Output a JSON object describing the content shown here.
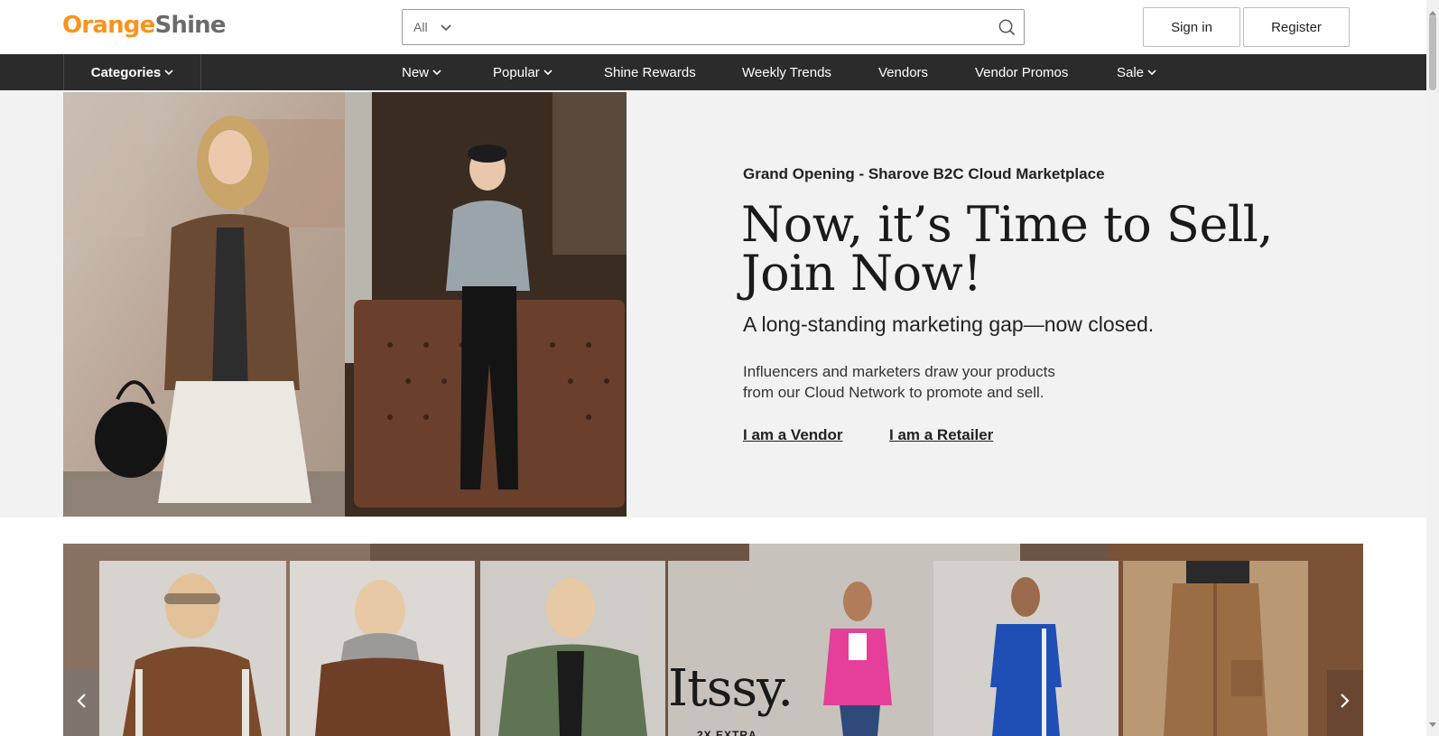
{
  "header": {
    "logo": {
      "part1": "Orange",
      "part2": "Shine"
    },
    "search": {
      "scope": "All",
      "placeholder": ""
    },
    "sign_in_label": "Sign in",
    "register_label": "Register"
  },
  "nav": {
    "categories_label": "Categories",
    "items": [
      {
        "label": "New",
        "dropdown": true
      },
      {
        "label": "Popular",
        "dropdown": true
      },
      {
        "label": "Shine Rewards",
        "dropdown": false
      },
      {
        "label": "Weekly Trends",
        "dropdown": false
      },
      {
        "label": "Vendors",
        "dropdown": false
      },
      {
        "label": "Vendor Promos",
        "dropdown": false
      },
      {
        "label": "Sale",
        "dropdown": true
      }
    ]
  },
  "hero": {
    "eyebrow": "Grand Opening - Sharove B2C Cloud Marketplace",
    "title_line1": "Now, it’s Time to Sell,",
    "title_line2": "Join Now!",
    "subtitle": "A long-standing marketing gap—now closed.",
    "desc_line1": "Influencers and marketers draw your products",
    "desc_line2": "from our Cloud Network to promote and sell.",
    "link_vendor": "I am a Vendor",
    "link_retailer": "I am a Retailer"
  },
  "carousel": {
    "brand": "Itssy.",
    "brand_sub": "2X EXTRA"
  },
  "colors": {
    "brand_orange": "#f7941d",
    "brand_gray": "#6b6b6b",
    "nav_bg": "#2b2b2b",
    "hero_bg": "#f2f2f2"
  },
  "icons": {
    "search": "search-icon",
    "chevron": "chevron-down-icon",
    "prev": "chevron-left-icon",
    "next": "chevron-right-icon"
  }
}
